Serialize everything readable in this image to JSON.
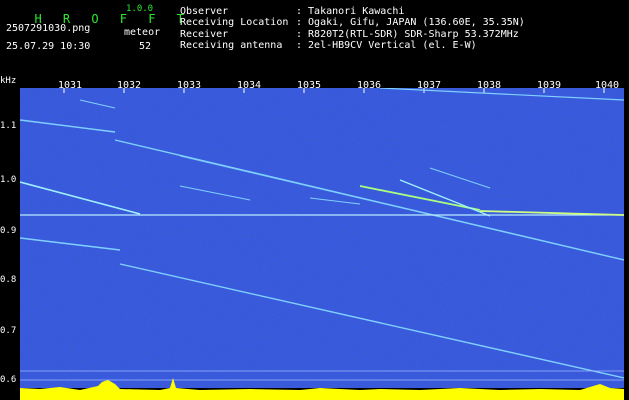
{
  "header": {
    "app_title": "H R O F F T",
    "version": "1.0.0",
    "filename": "2507291030.png",
    "timestamp": "25.07.29 10:30",
    "meteor_label": "meteor",
    "meteor_count": "52",
    "info": [
      {
        "key": "Observer",
        "value": ": Takanori Kawachi"
      },
      {
        "key": "Receiving Location",
        "value": ": Ogaki, Gifu, JAPAN (136.60E, 35.35N)"
      },
      {
        "key": "Receiver",
        "value": ": R820T2(RTL-SDR) SDR-Sharp 53.372MHz"
      },
      {
        "key": "Receiving antenna",
        "value": ": 2el-HB9CV Vertical (el. E-W)"
      }
    ]
  },
  "axes": {
    "y_unit": "kHz",
    "y_ticks": [
      "1.1",
      "1.0",
      "0.9",
      "0.8",
      "0.7",
      "0.6"
    ],
    "x_ticks": [
      "1031",
      "1032",
      "1033",
      "1034",
      "1035",
      "1036",
      "1037",
      "1038",
      "1039",
      "1040"
    ]
  },
  "colors": {
    "background": "#000000",
    "noise": "#0a1a6e",
    "trace": "#7fd0ff",
    "signal_peak": "#ffff00",
    "baseline": "#00c0ff"
  }
}
